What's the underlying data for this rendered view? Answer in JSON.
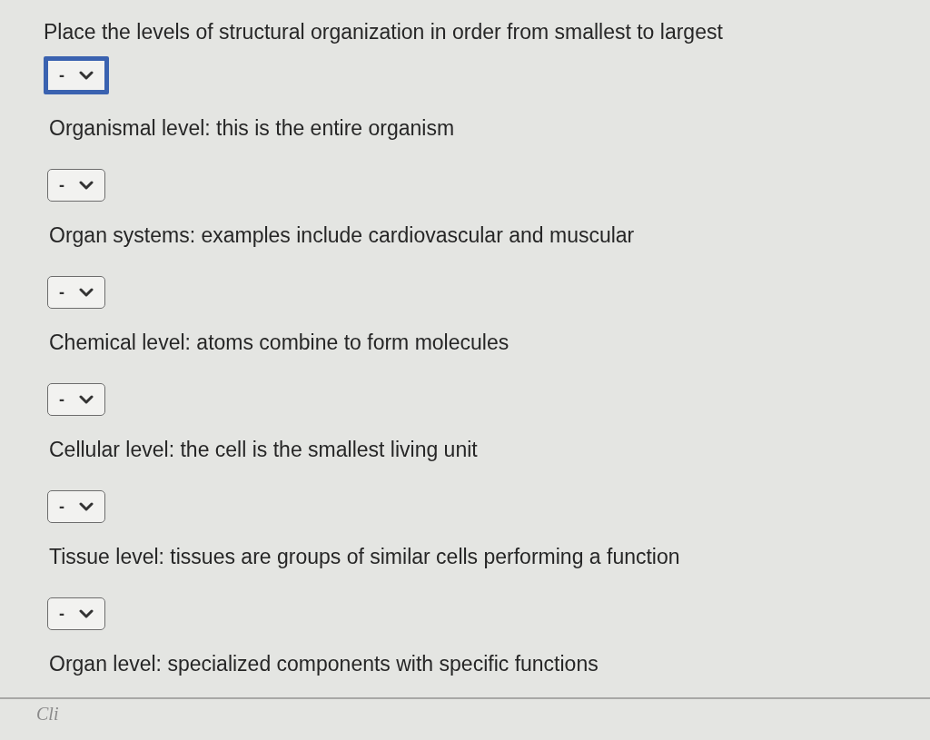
{
  "question": {
    "prompt": "Place the levels of structural organization in order from smallest to largest"
  },
  "items": [
    {
      "select": {
        "value": "-",
        "focused": true
      },
      "description": "Organismal level: this is the entire organism"
    },
    {
      "select": {
        "value": "-",
        "focused": false
      },
      "description": "Organ systems: examples include cardiovascular and muscular"
    },
    {
      "select": {
        "value": "-",
        "focused": false
      },
      "description": "Chemical level: atoms combine to form molecules"
    },
    {
      "select": {
        "value": "-",
        "focused": false
      },
      "description": "Cellular level: the cell is the smallest living unit"
    },
    {
      "select": {
        "value": "-",
        "focused": false
      },
      "description": "Tissue level: tissues are groups of similar cells performing a function"
    },
    {
      "select": {
        "value": "-",
        "focused": false
      },
      "description": "Organ level: specialized components with specific functions"
    }
  ],
  "footer": {
    "text": "Cli"
  }
}
